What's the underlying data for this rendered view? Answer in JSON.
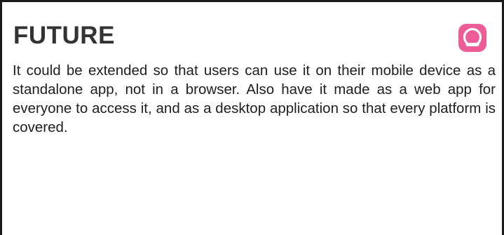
{
  "section": {
    "title": "FUTURE",
    "body": "It could be extended so that users can use it on their mobile device as a standalone app, not in a browser. Also have it made as a web app for everyone to access it, and as a desktop application so that every platform is covered.",
    "icon": "app-logo-icon",
    "icon_color": "#ee5c98"
  }
}
